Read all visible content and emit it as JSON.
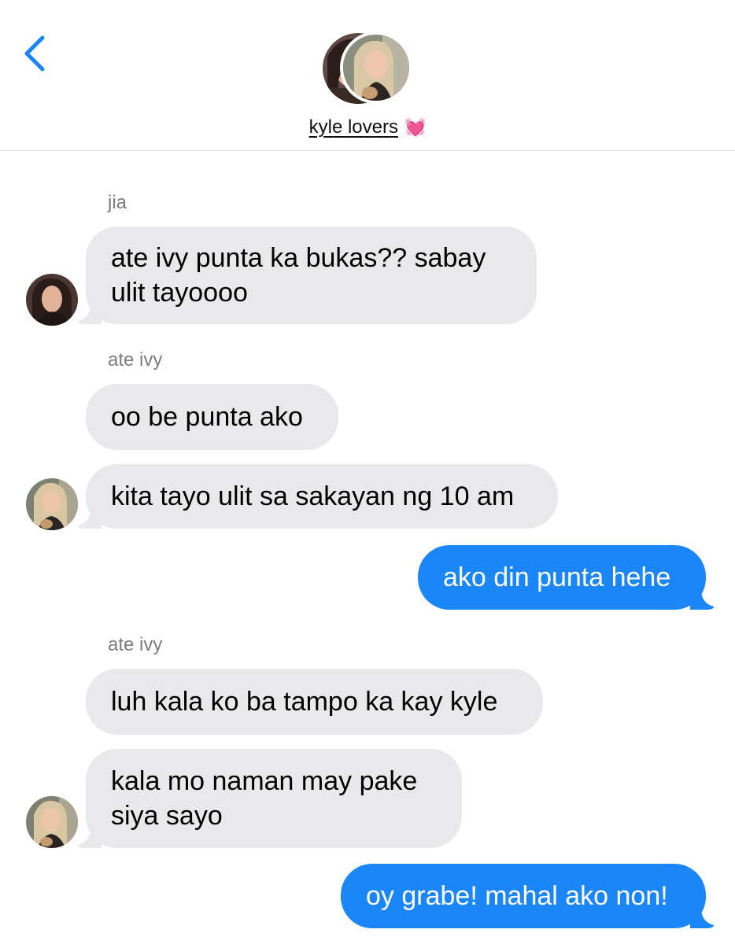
{
  "header": {
    "back_icon": "chevron-left-icon",
    "group_name": "kyle lovers",
    "group_emoji": "💓"
  },
  "colors": {
    "accent": "#1b86f7",
    "incoming_bubble": "#e9e9eb",
    "sender_label": "#7c7c80"
  },
  "messages": [
    {
      "sender": "jia"
    },
    {
      "text_line1": "ate ivy punta ka bukas?? sabay",
      "text_line2": "ulit tayoooo",
      "direction": "incoming"
    },
    {
      "sender": "ate ivy"
    },
    {
      "text": "oo be punta ako",
      "direction": "incoming"
    },
    {
      "text": "kita tayo ulit sa sakayan ng 10 am",
      "direction": "incoming"
    },
    {
      "text": "ako din punta hehe",
      "direction": "outgoing"
    },
    {
      "sender": "ate ivy"
    },
    {
      "text": "luh kala ko ba tampo ka kay kyle",
      "direction": "incoming"
    },
    {
      "text_line1": "kala mo naman may pake",
      "text_line2": "siya sayo",
      "direction": "incoming"
    },
    {
      "text": "oy grabe! mahal ako non!",
      "direction": "outgoing"
    }
  ]
}
